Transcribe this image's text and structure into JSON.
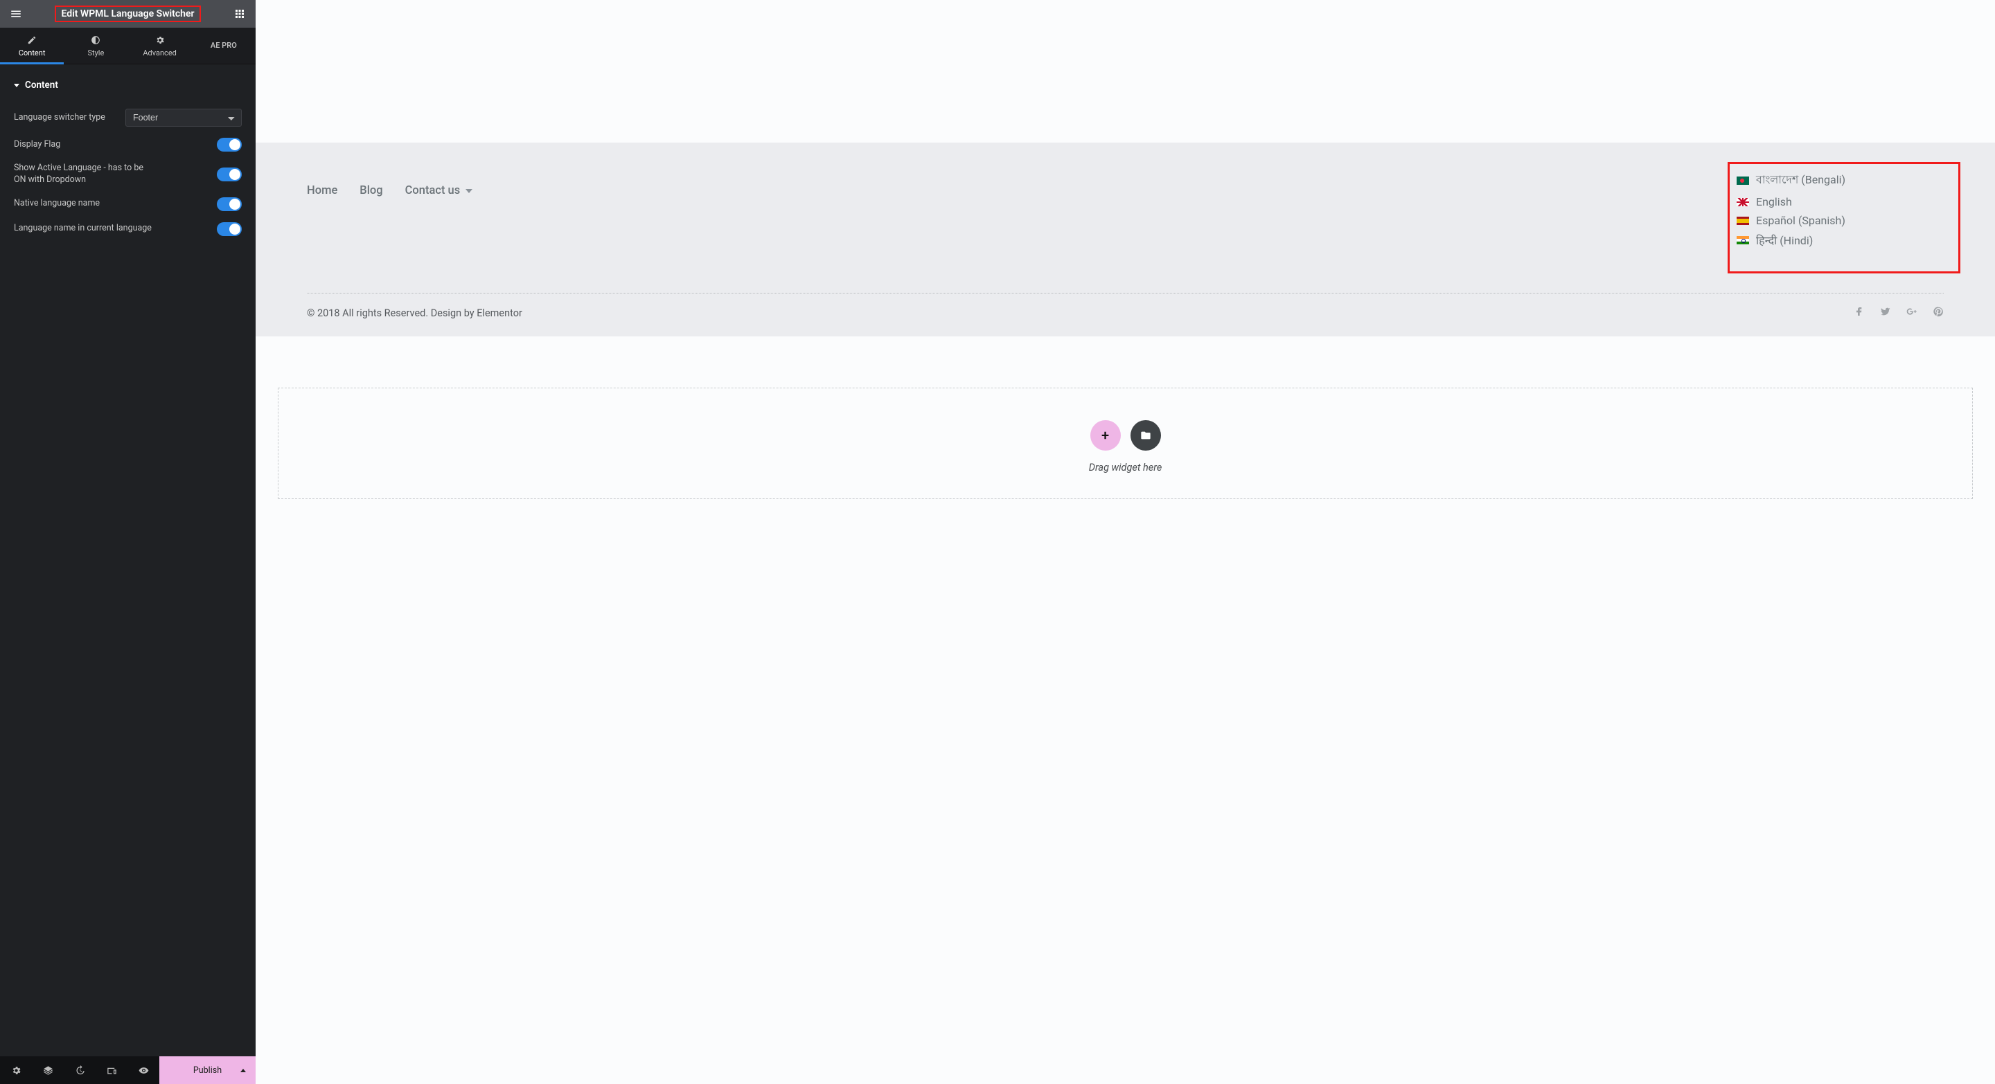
{
  "header": {
    "title": "Edit WPML Language Switcher"
  },
  "tabs": {
    "content": "Content",
    "style": "Style",
    "advanced": "Advanced",
    "ae_pro": "AE PRO"
  },
  "section": {
    "title": "Content"
  },
  "controls": {
    "switcher_type_label": "Language switcher type",
    "switcher_type_value": "Footer",
    "display_flag_label": "Display Flag",
    "show_active_label": "Show Active Language - has to be ON with Dropdown",
    "native_name_label": "Native language name",
    "current_name_label": "Language name in current language"
  },
  "bottom": {
    "publish": "Publish"
  },
  "canvas": {
    "nav": {
      "home": "Home",
      "blog": "Blog",
      "contact": "Contact us"
    },
    "languages": [
      {
        "flag": "bd",
        "text": "বাংলাদেশ (Bengali)"
      },
      {
        "flag": "uk",
        "text": "English"
      },
      {
        "flag": "es",
        "text": "Español (Spanish)"
      },
      {
        "flag": "in",
        "text": "हिन्दी (Hindi)"
      }
    ],
    "copyright": "© 2018 All rights Reserved. Design by Elementor",
    "drop": {
      "text": "Drag widget here"
    }
  }
}
